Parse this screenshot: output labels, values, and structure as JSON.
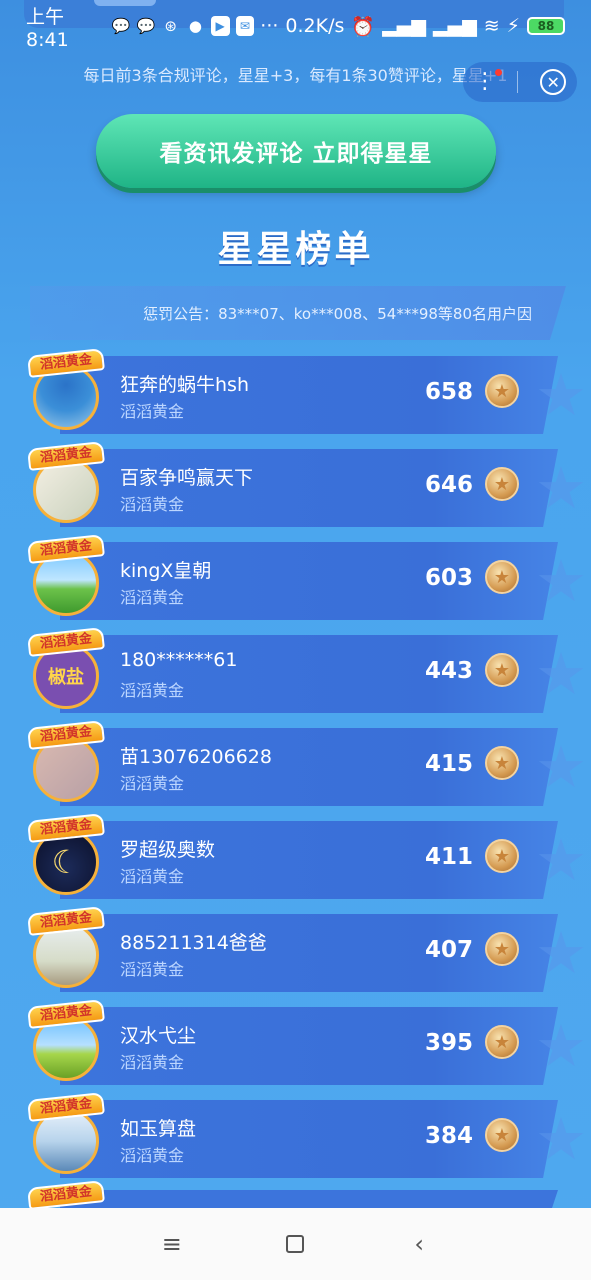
{
  "status_bar": {
    "time": "上午8:41",
    "net_speed": "0.2K/s",
    "battery": "88",
    "more": "···"
  },
  "notice": "每日前3条合规评论，星星+3，每有1条30赞评论，星星+1",
  "cta_label": "看资讯发评论 立即得星星",
  "title": "星星榜单",
  "penalty": "惩罚公告：83***07、ko***008、54***98等80名用户因",
  "badge": "滔滔黄金",
  "entries": [
    {
      "name": "狂奔的蜗牛hsh",
      "level": "滔滔黄金",
      "score": "658"
    },
    {
      "name": "百家争鸣赢天下",
      "level": "滔滔黄金",
      "score": "646"
    },
    {
      "name": "kingX皇朝",
      "level": "滔滔黄金",
      "score": "603"
    },
    {
      "name": "180******61",
      "level": "滔滔黄金",
      "score": "443",
      "avatar_text": "椒盐"
    },
    {
      "name": "苗13076206628",
      "level": "滔滔黄金",
      "score": "415"
    },
    {
      "name": "罗超级奥数",
      "level": "滔滔黄金",
      "score": "411"
    },
    {
      "name": "885211314爸爸",
      "level": "滔滔黄金",
      "score": "407"
    },
    {
      "name": "汉水弋尘",
      "level": "滔滔黄金",
      "score": "395"
    },
    {
      "name": "如玉算盘",
      "level": "滔滔黄金",
      "score": "384"
    }
  ],
  "icons": {
    "menu": "menu-icon",
    "home": "home-icon",
    "back": "back-icon",
    "close": "close-icon",
    "more": "more-vertical-icon",
    "coin": "star-coin-icon"
  }
}
